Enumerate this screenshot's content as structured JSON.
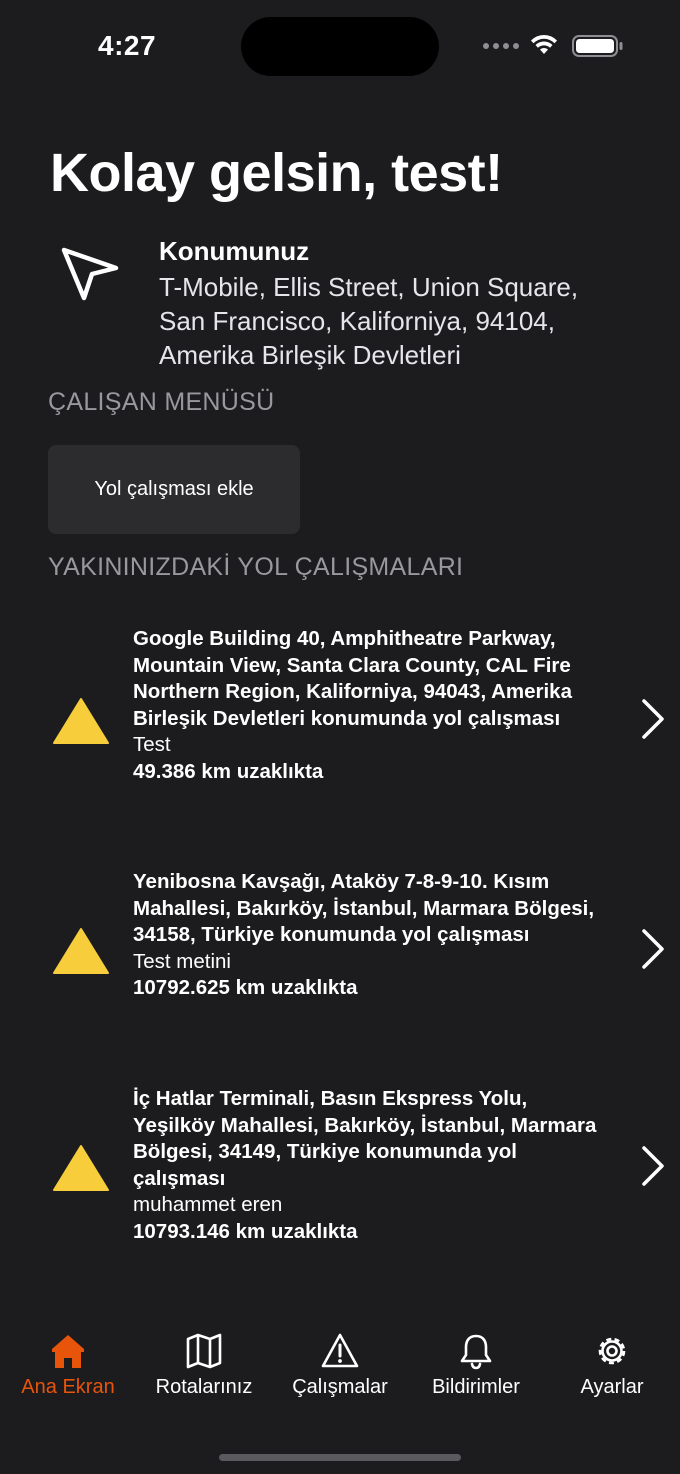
{
  "status_bar": {
    "time": "4:27"
  },
  "greeting": "Kolay gelsin, test!",
  "location": {
    "title": "Konumunuz",
    "address": "T-Mobile, Ellis Street, Union Square, San Francisco, Kaliforniya, 94104, Amerika Birleşik Devletleri"
  },
  "employee_menu": {
    "header": "ÇALIŞAN MENÜSÜ",
    "add_button": "Yol çalışması ekle"
  },
  "nearby": {
    "header": "YAKININIZDAKİ YOL ÇALIŞMALARI",
    "items": [
      {
        "title": "Google Building 40, Amphitheatre Parkway, Mountain View, Santa Clara County, CAL Fire Northern Region, Kaliforniya, 94043, Amerika Birleşik Devletleri konumunda yol çalışması",
        "description": "Test",
        "distance": "49.386 km uzaklıkta"
      },
      {
        "title": "Yenibosna Kavşağı, Ataköy 7-8-9-10. Kısım Mahallesi, Bakırköy, İstanbul, Marmara Bölgesi, 34158, Türkiye konumunda yol çalışması",
        "description": "Test metini",
        "distance": "10792.625 km uzaklıkta"
      },
      {
        "title": "İç Hatlar Terminali, Basın Ekspress Yolu, Yeşilköy Mahallesi, Bakırköy, İstanbul, Marmara Bölgesi, 34149, Türkiye konumunda yol çalışması",
        "description": "muhammet eren",
        "distance": "10793.146 km uzaklıkta"
      }
    ]
  },
  "tabbar": {
    "tabs": [
      {
        "label": "Ana Ekran",
        "icon": "house-icon"
      },
      {
        "label": "Rotalarınız",
        "icon": "map-icon"
      },
      {
        "label": "Çalışmalar",
        "icon": "warning-icon"
      },
      {
        "label": "Bildirimler",
        "icon": "bell-icon"
      },
      {
        "label": "Ayarlar",
        "icon": "gear-icon"
      }
    ],
    "active_index": 0
  },
  "colors": {
    "background": "#1c1c1e",
    "accent": "#e8540a",
    "warning": "#f7cd3b",
    "button_bg": "#2c2c2e",
    "secondary_text": "#98989d"
  }
}
